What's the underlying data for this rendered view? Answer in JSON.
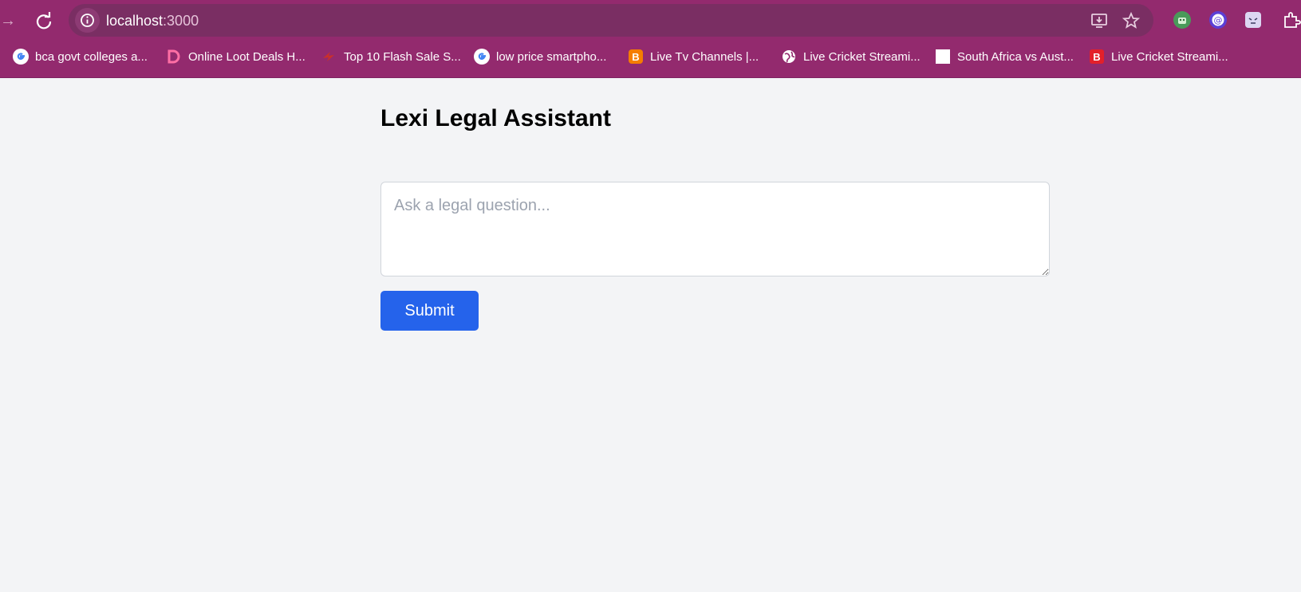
{
  "browser": {
    "url_host": "localhost",
    "url_port": ":3000",
    "bookmarks": [
      {
        "label": "bca govt colleges a...",
        "icon": "google-icon"
      },
      {
        "label": "Online Loot Deals H...",
        "icon": "d-logo-icon"
      },
      {
        "label": "Top 10 Flash Sale S...",
        "icon": "flash-sale-icon"
      },
      {
        "label": "low price smartpho...",
        "icon": "google-icon"
      },
      {
        "label": "Live Tv Channels |...",
        "icon": "blogger-icon"
      },
      {
        "label": "Live Cricket Streami...",
        "icon": "globe-icon"
      },
      {
        "label": "South Africa vs Aust...",
        "icon": "blank-page-icon"
      },
      {
        "label": "Live Cricket Streami...",
        "icon": "b-logo-icon"
      }
    ]
  },
  "page": {
    "title": "Lexi Legal Assistant",
    "question_placeholder": "Ask a legal question...",
    "question_value": "",
    "submit_label": "Submit"
  },
  "colors": {
    "chrome": "#932a6e",
    "omnibox": "#7a2e63",
    "page_background": "#f3f4f6",
    "button": "#2563eb"
  }
}
